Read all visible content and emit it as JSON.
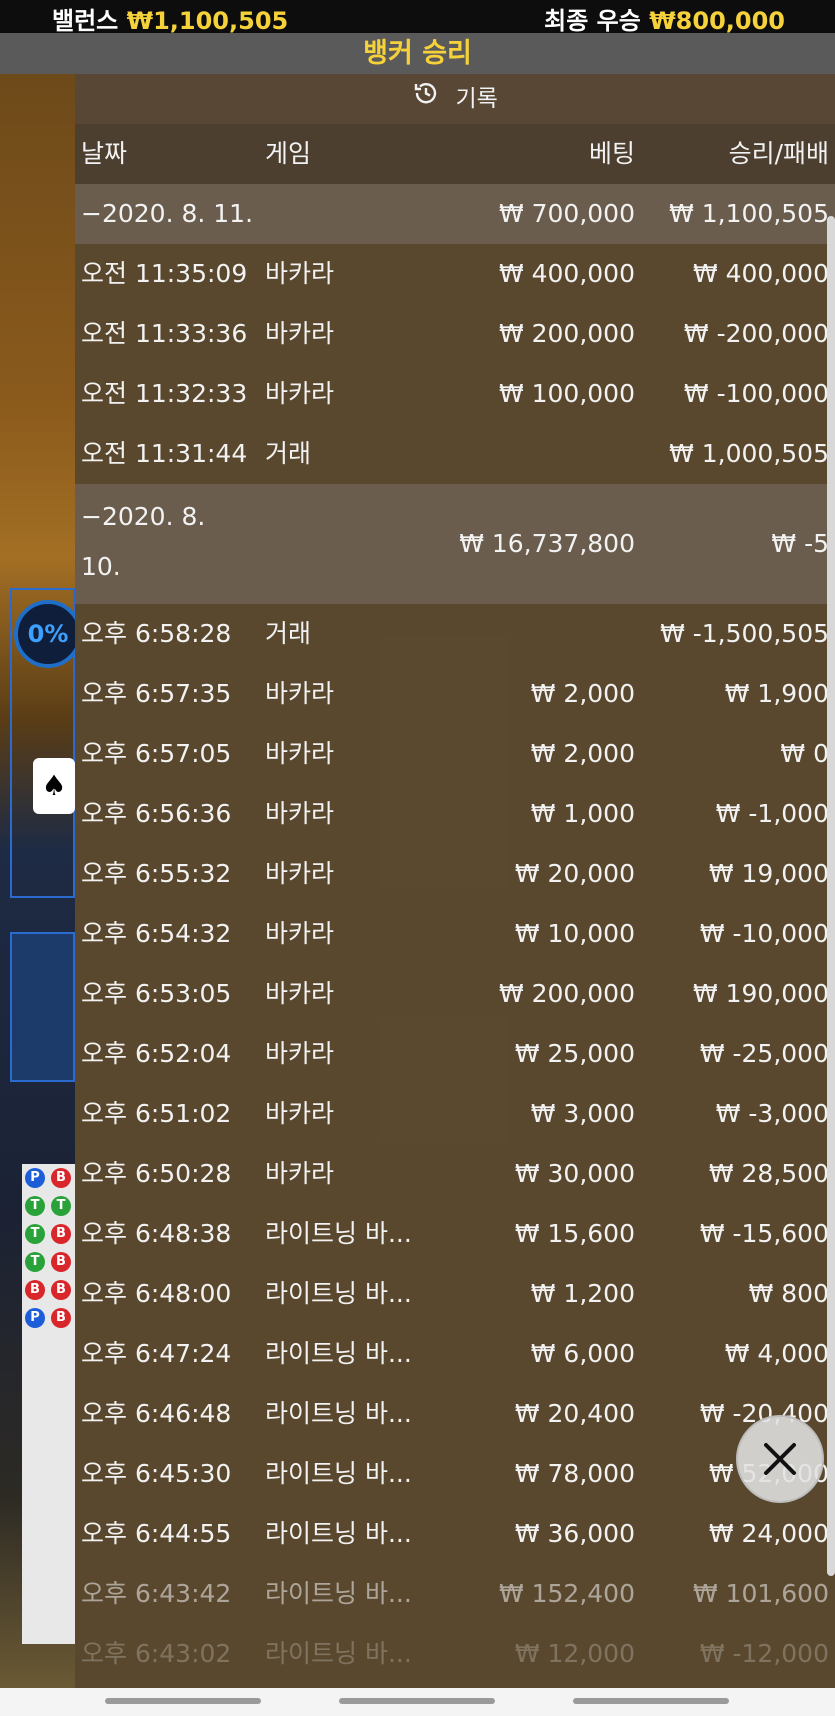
{
  "top_bar": {
    "balance_label": "밸런스",
    "balance_value": "₩1,100,505",
    "final_win_label": "최종 우승",
    "final_win_value": "₩800,000"
  },
  "banner": {
    "text": "뱅커 승리"
  },
  "record": {
    "title": "기록",
    "columns": {
      "date": "날짜",
      "game": "게임",
      "bet": "베팅",
      "winloss": "승리/패배"
    },
    "group1": {
      "date": "−2020. 8. 11.",
      "bet": "₩ 700,000",
      "winloss": "₩ 1,100,505",
      "rows": [
        {
          "time": "오전 11:35:09",
          "game": "바카라",
          "bet": "₩ 400,000",
          "winloss": "₩ 400,000"
        },
        {
          "time": "오전 11:33:36",
          "game": "바카라",
          "bet": "₩ 200,000",
          "winloss": "₩ -200,000"
        },
        {
          "time": "오전 11:32:33",
          "game": "바카라",
          "bet": "₩ 100,000",
          "winloss": "₩ -100,000"
        },
        {
          "time": "오전 11:31:44",
          "game": "거래",
          "bet": "",
          "winloss": "₩ 1,000,505"
        }
      ]
    },
    "group2": {
      "date": "−2020. 8. 10.",
      "bet": "₩ 16,737,800",
      "winloss": "₩ -5",
      "rows": [
        {
          "time": "오후 6:58:28",
          "game": "거래",
          "bet": "",
          "winloss": "₩ -1,500,505"
        },
        {
          "time": "오후 6:57:35",
          "game": "바카라",
          "bet": "₩ 2,000",
          "winloss": "₩ 1,900"
        },
        {
          "time": "오후 6:57:05",
          "game": "바카라",
          "bet": "₩ 2,000",
          "winloss": "₩ 0"
        },
        {
          "time": "오후 6:56:36",
          "game": "바카라",
          "bet": "₩ 1,000",
          "winloss": "₩ -1,000"
        },
        {
          "time": "오후 6:55:32",
          "game": "바카라",
          "bet": "₩ 20,000",
          "winloss": "₩ 19,000"
        },
        {
          "time": "오후 6:54:32",
          "game": "바카라",
          "bet": "₩ 10,000",
          "winloss": "₩ -10,000"
        },
        {
          "time": "오후 6:53:05",
          "game": "바카라",
          "bet": "₩ 200,000",
          "winloss": "₩ 190,000"
        },
        {
          "time": "오후 6:52:04",
          "game": "바카라",
          "bet": "₩ 25,000",
          "winloss": "₩ -25,000"
        },
        {
          "time": "오후 6:51:02",
          "game": "바카라",
          "bet": "₩ 3,000",
          "winloss": "₩ -3,000"
        },
        {
          "time": "오후 6:50:28",
          "game": "바카라",
          "bet": "₩ 30,000",
          "winloss": "₩ 28,500"
        },
        {
          "time": "오후 6:48:38",
          "game": "라이트닝 바...",
          "bet": "₩ 15,600",
          "winloss": "₩ -15,600"
        },
        {
          "time": "오후 6:48:00",
          "game": "라이트닝 바...",
          "bet": "₩ 1,200",
          "winloss": "₩ 800"
        },
        {
          "time": "오후 6:47:24",
          "game": "라이트닝 바...",
          "bet": "₩ 6,000",
          "winloss": "₩ 4,000"
        },
        {
          "time": "오후 6:46:48",
          "game": "라이트닝 바...",
          "bet": "₩ 20,400",
          "winloss": "₩ -20,400"
        },
        {
          "time": "오후 6:45:30",
          "game": "라이트닝 바...",
          "bet": "₩ 78,000",
          "winloss": "₩ 52,000"
        },
        {
          "time": "오후 6:44:55",
          "game": "라이트닝 바...",
          "bet": "₩ 36,000",
          "winloss": "₩ 24,000"
        },
        {
          "time": "오후 6:43:42",
          "game": "라이트닝 바...",
          "bet": "₩ 152,400",
          "winloss": "₩ 101,600"
        },
        {
          "time": "오후 6:43:02",
          "game": "라이트닝 바...",
          "bet": "₩ 12,000",
          "winloss": "₩ -12,000"
        }
      ]
    }
  },
  "background": {
    "gauge": "0%"
  },
  "icons": {
    "history": "history-clock-icon",
    "close": "close-x-icon"
  }
}
